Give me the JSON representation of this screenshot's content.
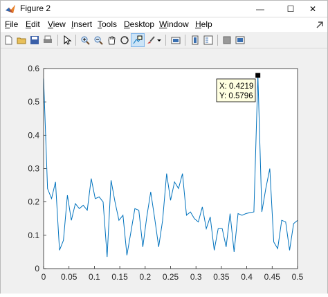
{
  "window": {
    "title": "Figure 2",
    "minimize_glyph": "—",
    "maximize_glyph": "☐",
    "close_glyph": "✕"
  },
  "menu": {
    "items": [
      {
        "name": "file",
        "text": "File",
        "ul": "F",
        "rest": "ile"
      },
      {
        "name": "edit",
        "text": "Edit",
        "ul": "E",
        "rest": "dit"
      },
      {
        "name": "view",
        "text": "View",
        "ul": "V",
        "rest": "iew"
      },
      {
        "name": "insert",
        "text": "Insert",
        "ul": "I",
        "rest": "nsert"
      },
      {
        "name": "tools",
        "text": "Tools",
        "ul": "T",
        "rest": "ools"
      },
      {
        "name": "desktop",
        "text": "Desktop",
        "ul": "D",
        "rest": "esktop"
      },
      {
        "name": "window",
        "text": "Window",
        "ul": "W",
        "rest": "indow"
      },
      {
        "name": "help",
        "text": "Help",
        "ul": "H",
        "rest": "elp"
      }
    ]
  },
  "toolbar": {
    "buttons": [
      "new-figure-icon",
      "open-file-icon",
      "save-icon",
      "print-icon",
      "edit-plot-arrow-icon",
      "zoom-in-icon",
      "zoom-out-icon",
      "pan-hand-icon",
      "rotate-3d-icon",
      "data-cursor-icon",
      "brush-icon",
      "brush-dropdown-icon",
      "link-plot-icon",
      "colorbar-icon",
      "legend-icon",
      "hide-plot-tools-icon",
      "show-plot-tools-icon"
    ],
    "active": "data-cursor-icon"
  },
  "colors": {
    "line": "#0072bd",
    "datatip_bg": "#ffffe1"
  },
  "datatip": {
    "x_text": "X: 0.4219",
    "y_text": "Y: 0.5796"
  },
  "chart_data": {
    "type": "line",
    "xlim": [
      0,
      0.5
    ],
    "ylim": [
      0,
      0.6
    ],
    "xticks": [
      "0",
      "0.05",
      "0.1",
      "0.15",
      "0.2",
      "0.25",
      "0.3",
      "0.35",
      "0.4",
      "0.45",
      "0.5"
    ],
    "yticks": [
      "0",
      "0.1",
      "0.2",
      "0.3",
      "0.4",
      "0.5",
      "0.6"
    ],
    "grid": false,
    "series": [
      {
        "x": [
          0,
          0.0078,
          0.0156,
          0.0234,
          0.0313,
          0.0391,
          0.0469,
          0.0547,
          0.0625,
          0.0703,
          0.0781,
          0.0859,
          0.0938,
          0.1016,
          0.1094,
          0.1172,
          0.125,
          0.1328,
          0.1406,
          0.1484,
          0.1563,
          0.1641,
          0.1719,
          0.1797,
          0.1875,
          0.1953,
          0.2031,
          0.2109,
          0.2188,
          0.2266,
          0.2344,
          0.2422,
          0.25,
          0.2578,
          0.2656,
          0.2734,
          0.2813,
          0.2891,
          0.2969,
          0.3047,
          0.3125,
          0.3203,
          0.3281,
          0.3359,
          0.3438,
          0.3516,
          0.3594,
          0.3672,
          0.375,
          0.3828,
          0.3906,
          0.3984,
          0.4063,
          0.4141,
          0.4219,
          0.4297,
          0.4375,
          0.4453,
          0.4531,
          0.4609,
          0.4688,
          0.4766,
          0.4844,
          0.4922,
          0.5
        ],
        "y": [
          0.57,
          0.24,
          0.21,
          0.26,
          0.055,
          0.085,
          0.22,
          0.145,
          0.195,
          0.18,
          0.19,
          0.175,
          0.27,
          0.21,
          0.215,
          0.2,
          0.035,
          0.265,
          0.2,
          0.145,
          0.16,
          0.04,
          0.11,
          0.18,
          0.175,
          0.065,
          0.155,
          0.23,
          0.15,
          0.065,
          0.145,
          0.285,
          0.205,
          0.26,
          0.24,
          0.285,
          0.16,
          0.17,
          0.15,
          0.14,
          0.185,
          0.12,
          0.155,
          0.055,
          0.12,
          0.12,
          0.065,
          0.165,
          0.05,
          0.165,
          0.16,
          0.165,
          0.168,
          0.17,
          0.5796,
          0.17,
          0.24,
          0.3,
          0.08,
          0.06,
          0.145,
          0.14,
          0.055,
          0.135,
          0.145
        ]
      }
    ]
  }
}
